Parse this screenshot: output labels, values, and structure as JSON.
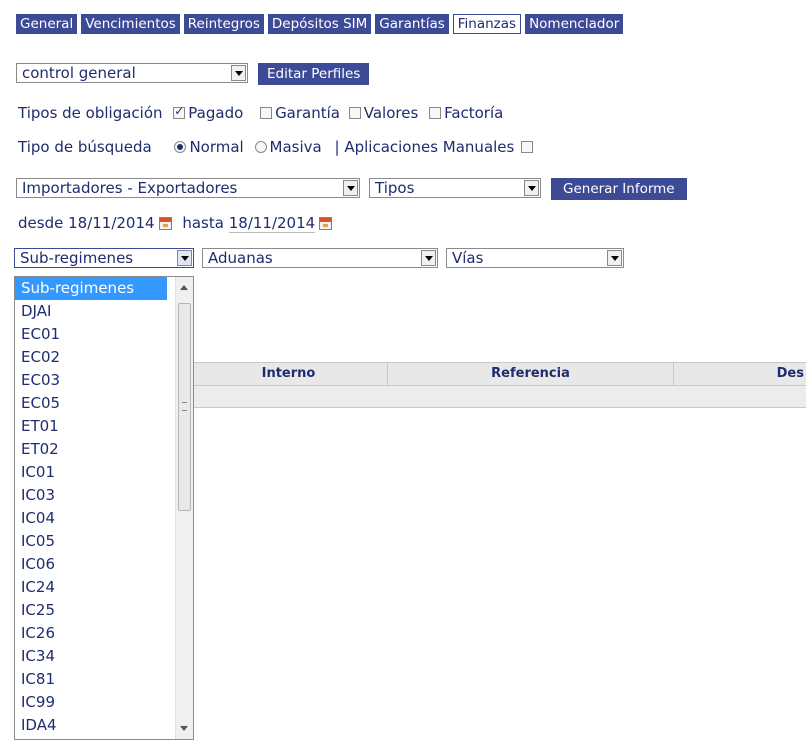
{
  "tabs": [
    {
      "label": "General"
    },
    {
      "label": "Vencimientos"
    },
    {
      "label": "Reintegros"
    },
    {
      "label": "Depósitos SIM"
    },
    {
      "label": "Garantías"
    },
    {
      "label": "Finanzas"
    },
    {
      "label": "Nomenclador"
    }
  ],
  "active_tab": "Finanzas",
  "profile": {
    "selected": "control general",
    "edit_button": "Editar Perfiles"
  },
  "obligation": {
    "label": "Tipos de obligación",
    "options": [
      {
        "label": "Pagado",
        "checked": true
      },
      {
        "label": "Garantía",
        "checked": false
      },
      {
        "label": "Valores",
        "checked": false
      },
      {
        "label": "Factoría",
        "checked": false
      }
    ]
  },
  "search_type": {
    "label": "Tipo de búsqueda",
    "normal": "Normal",
    "masiva": "Masiva",
    "separator": "|",
    "manual_label": "Aplicaciones Manuales",
    "selected": "Normal",
    "manual_checked": false
  },
  "filters": {
    "importers": "Importadores - Exportadores",
    "tipos": "Tipos",
    "generate_button": "Generar Informe"
  },
  "dates": {
    "desde_label": "desde",
    "desde_value": "18/11/2014",
    "hasta_label": "hasta",
    "hasta_value": "18/11/2014"
  },
  "selects2": {
    "subregimenes": "Sub-regimenes",
    "aduanas": "Aduanas",
    "vias": "Vías"
  },
  "table": {
    "columns": [
      "Interno",
      "Referencia",
      "Des"
    ]
  },
  "dropdown": {
    "selected": "Sub-regimenes",
    "items": [
      "Sub-regimenes",
      "DJAI",
      "EC01",
      "EC02",
      "EC03",
      "EC05",
      "ET01",
      "ET02",
      "IC01",
      "IC03",
      "IC04",
      "IC05",
      "IC06",
      "IC24",
      "IC25",
      "IC26",
      "IC34",
      "IC81",
      "IC99",
      "IDA4"
    ]
  },
  "colors": {
    "accent": "#3d4a96",
    "text": "#1f2c6e",
    "highlight": "#3399ff"
  }
}
